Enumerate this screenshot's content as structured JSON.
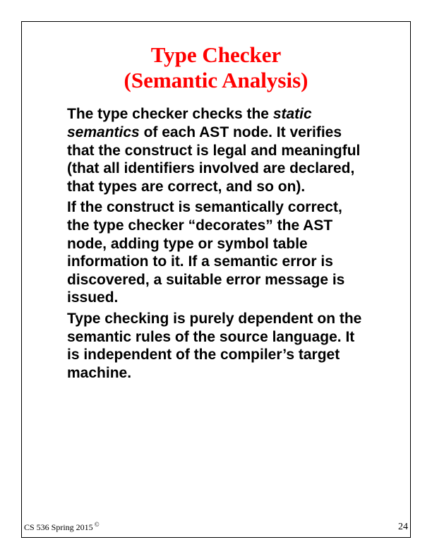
{
  "title": {
    "line1": "Type Checker",
    "line2": "(Semantic Analysis)"
  },
  "paragraphs": {
    "p1_pre": "The type checker checks the ",
    "p1_italic": "static semantics",
    "p1_post": " of each AST node. It verifies that the construct is legal and meaningful (that all identifiers involved are declared, that types are correct, and so on).",
    "p2": "If the construct is semantically correct, the type checker “decorates” the AST node, adding type or symbol table information to it. If a semantic error is discovered, a suitable error message is issued.",
    "p3": "Type checking is purely dependent on the semantic rules of the source language. It is independent of the compiler’s target machine."
  },
  "footer": {
    "course": "CS 536  Spring 2015",
    "copyright": "©",
    "page": "24"
  }
}
